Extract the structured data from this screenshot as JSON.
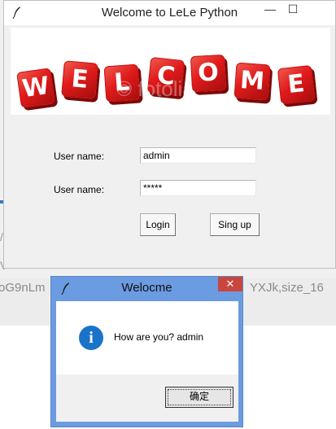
{
  "background": {
    "left_text": "oG9nLm",
    "right_text": "YXJk,size_16"
  },
  "window": {
    "title": "Welcome to LeLe Python",
    "minimize_glyph": "—",
    "maximize_glyph": "☐"
  },
  "banner": {
    "letters": [
      "W",
      "E",
      "L",
      "C",
      "O",
      "M",
      "E"
    ],
    "watermark": "© fotolia"
  },
  "form": {
    "username_label": "User name:",
    "username_value": "admin",
    "password_label": "User name:",
    "password_value": "*****"
  },
  "buttons": {
    "login": "Login",
    "signup": "Sing up"
  },
  "dialog": {
    "title": "Welocme",
    "close_glyph": "✕",
    "message": "How are you? admin",
    "ok_label": "确定",
    "icon_glyph": "i"
  },
  "colors": {
    "dialog_border": "#6b9be0",
    "close_button": "#c8463d",
    "cube_red": "#e01b1b",
    "info_icon": "#1a73c9"
  }
}
